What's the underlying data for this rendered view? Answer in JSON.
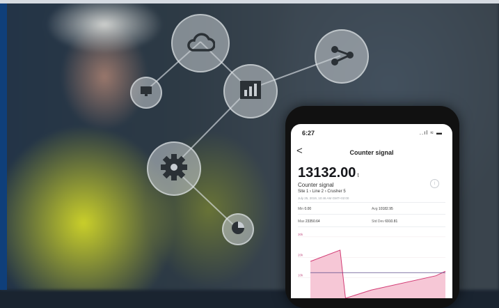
{
  "icons": {
    "cloud": "cloud-icon",
    "monitor": "monitor-icon",
    "chart": "bar-chart-icon",
    "share": "share-icon",
    "gear": "gear-icon",
    "pie": "pie-chart-icon"
  },
  "colors": {
    "accent": "#c2185b",
    "chart_fill": "#f6c7d6",
    "chart_line": "#d23b74",
    "threshold_line": "#5a4a8a"
  },
  "phone": {
    "status_time": "6:27",
    "status_icons": "..ıl ≈ ▬",
    "back_label": "<",
    "title": "Counter signal",
    "value": "13132.00",
    "unit": "t",
    "signal_name": "Counter signal",
    "path": "Site 1 › Line 2 › Crusher 5",
    "timestamp": "July 25, 2019, 10:46 AM GMT+02:00",
    "info_label": "i",
    "stats": {
      "min_label": "Min",
      "min_value": "0.00",
      "avg_label": "Avg",
      "avg_value": "10182.95",
      "max_label": "Max",
      "max_value": "23350.64",
      "std_label": "Std Dev",
      "std_value": "6910.81"
    }
  },
  "chart_data": {
    "type": "area",
    "ylabels": [
      "30k",
      "20k",
      "10k"
    ],
    "ylim": [
      0,
      32000
    ],
    "threshold": 12500,
    "x": [
      0,
      0.22,
      0.26,
      0.45,
      0.93,
      1.0
    ],
    "values": [
      18000,
      23500,
      0,
      4000,
      11000,
      13200
    ]
  }
}
